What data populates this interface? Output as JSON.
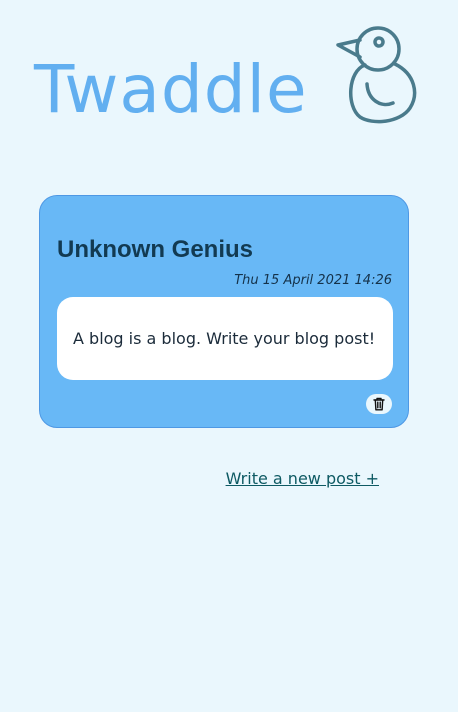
{
  "app": {
    "logo_text": "Twaddle",
    "logo_icon": "bird-icon"
  },
  "colors": {
    "background": "#eaf7fd",
    "logo_text": "#62aff0",
    "logo_bird": "#4a7b8c",
    "card": "#68b8f6",
    "card_border": "#4e98e4",
    "link": "#0e5a63"
  },
  "posts": [
    {
      "author": "Unknown Genius",
      "date": "Thu 15 April 2021 14:26",
      "body": "A blog is a blog. Write your blog post!",
      "delete_icon": "trash-icon"
    }
  ],
  "actions": {
    "new_post_label": "Write a new post +"
  }
}
